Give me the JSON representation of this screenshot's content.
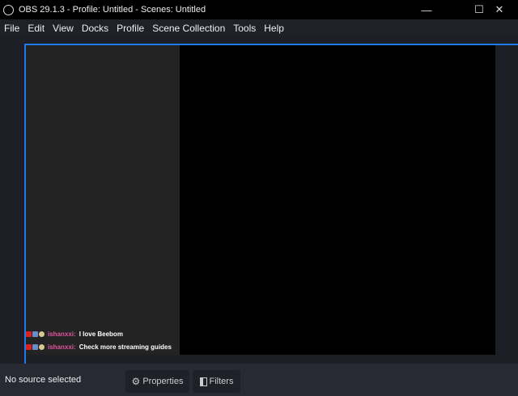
{
  "window": {
    "title": "OBS 29.1.3 - Profile: Untitled - Scenes: Untitled",
    "minimize": "—",
    "maximize": "☐",
    "close": "✕"
  },
  "menu": [
    "File",
    "Edit",
    "View",
    "Docks",
    "Profile",
    "Scene Collection",
    "Tools",
    "Help"
  ],
  "chat": [
    {
      "user": "ishanxxi:",
      "text": "I love Beebom"
    },
    {
      "user": "ishanxxi:",
      "text": "Check more streaming guides"
    }
  ],
  "status": {
    "no_source": "No source selected"
  },
  "buttons": {
    "properties": "Properties",
    "filters": "Filters",
    "properties_icon": "gear-icon",
    "filters_icon": "filter-icon"
  },
  "colors": {
    "accent": "#1f7ae8",
    "username": "#e0559f"
  }
}
